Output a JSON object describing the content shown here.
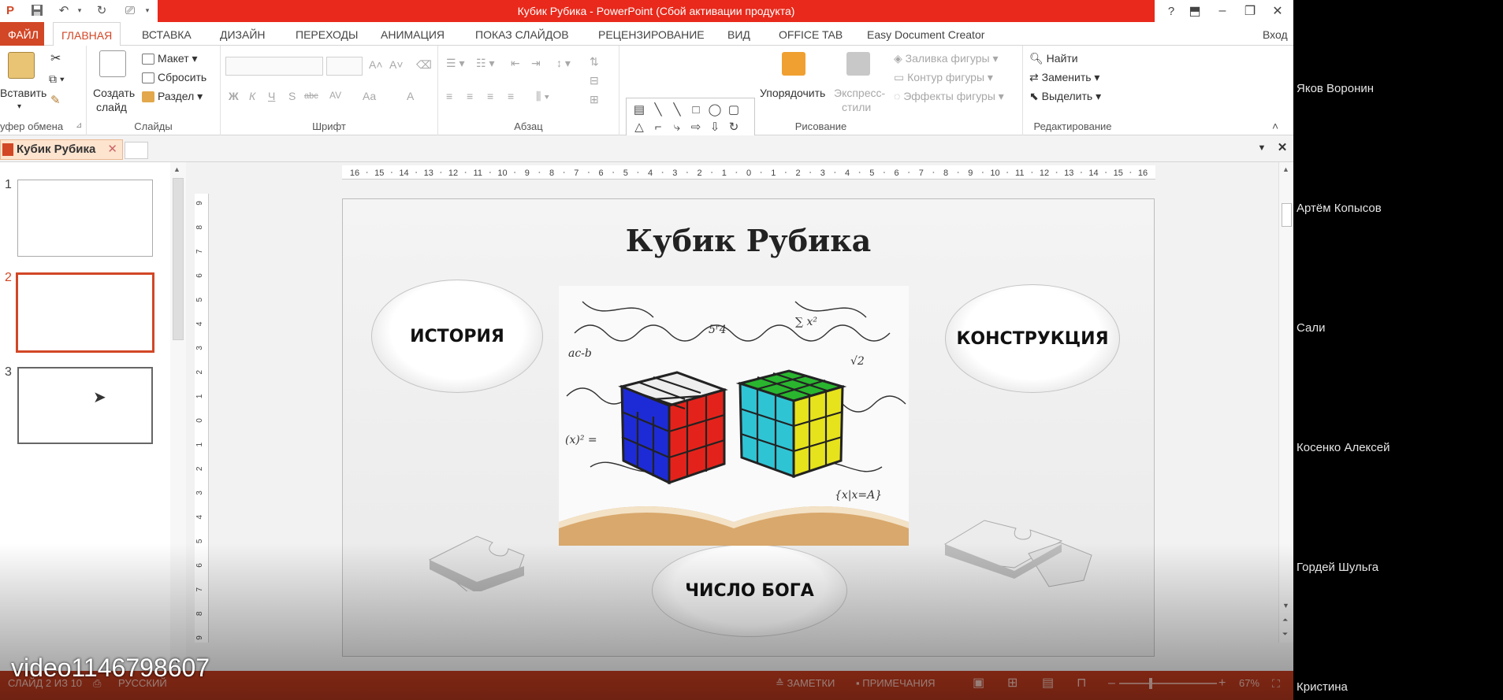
{
  "window": {
    "title": "Кубик Рубика -  PowerPoint (Сбой активации продукта)",
    "help": "?"
  },
  "ribbon_tabs": [
    "ФАЙЛ",
    "ГЛАВНАЯ",
    "ВСТАВКА",
    "ДИЗАЙН",
    "ПЕРЕХОДЫ",
    "АНИМАЦИЯ",
    "ПОКАЗ СЛАЙДОВ",
    "РЕЦЕНЗИРОВАНИЕ",
    "ВИД",
    "OFFICE TAB",
    "Easy Document Creator",
    "Вход"
  ],
  "ribbon": {
    "clipboard": {
      "paste": "Вставить",
      "label": "уфер обмена"
    },
    "slides": {
      "create": "Создать",
      "create2": "слайд",
      "layout": "Макет",
      "reset": "Сбросить",
      "section": "Раздел",
      "label": "Слайды"
    },
    "font": {
      "label": "Шрифт",
      "buttons": [
        "Ж",
        "К",
        "Ч",
        "S",
        "abc",
        "AV",
        "Aa",
        "A"
      ]
    },
    "paragraph": {
      "label": "Абзац"
    },
    "drawing": {
      "arrange": "Упорядочить",
      "quick1": "Экспресс-",
      "quick2": "стили",
      "fill": "Заливка фигуры",
      "outline": "Контур фигуры",
      "effects": "Эффекты фигуры",
      "label": "Рисование"
    },
    "editing": {
      "find": "Найти",
      "replace": "Заменить",
      "select": "Выделить",
      "label": "Редактирование"
    }
  },
  "doc_tab": {
    "name": "Кубик Рубика"
  },
  "thumbnails": [
    "1",
    "2",
    "3"
  ],
  "ruler_h": [
    "16",
    "15",
    "14",
    "13",
    "12",
    "11",
    "10",
    "9",
    "8",
    "7",
    "6",
    "5",
    "4",
    "3",
    "2",
    "1",
    "0",
    "1",
    "2",
    "3",
    "4",
    "5",
    "6",
    "7",
    "8",
    "9",
    "10",
    "11",
    "12",
    "13",
    "14",
    "15",
    "16"
  ],
  "ruler_v": [
    "9",
    "8",
    "7",
    "6",
    "5",
    "4",
    "3",
    "2",
    "1",
    "0",
    "1",
    "2",
    "3",
    "4",
    "5",
    "6",
    "7",
    "8",
    "9"
  ],
  "slide": {
    "title": "Кубик Рубика",
    "ovals": {
      "history": "ИСТОРИЯ",
      "construction": "КОНСТРУКЦИЯ",
      "gods_number": "ЧИСЛО БОГА"
    }
  },
  "statusbar": {
    "slide": "СЛАЙД 2 ИЗ 10",
    "lang": "РУССКИЙ",
    "notes": "ЗАМЕТКИ",
    "comments": "ПРИМЕЧАНИЯ",
    "zoom": "67%"
  },
  "watermark": "video1146798607",
  "participants": [
    "Яков Воронин",
    "Артём Копысов",
    "Сали",
    "Косенко Алексей",
    "Гордей Шульга",
    "Кристина"
  ],
  "colors": {
    "accent": "#d24726",
    "titlebar": "#e8291b",
    "statusbar": "#c03a1e"
  }
}
